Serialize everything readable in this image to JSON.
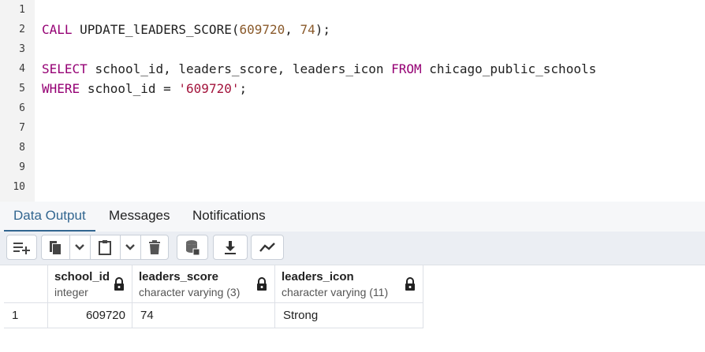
{
  "editor": {
    "line_numbers": [
      "1",
      "2",
      "3",
      "4",
      "5",
      "6",
      "7",
      "8",
      "9",
      "10"
    ],
    "line2": {
      "kw": "CALL",
      "fn": "UPDATE_lEADERS_SCORE",
      "open": "(",
      "arg1": "609720",
      "comma": ", ",
      "arg2": "74",
      "close": ");"
    },
    "line4": {
      "kw1": "SELECT",
      "cols": "school_id, leaders_score, leaders_icon",
      "kw2": "FROM",
      "table": "chicago_public_schools"
    },
    "line5": {
      "kw": "WHERE",
      "cond": "school_id = ",
      "val": "'609720'",
      "end": ";"
    }
  },
  "tabs": [
    {
      "label": "Data Output",
      "active": true
    },
    {
      "label": "Messages",
      "active": false
    },
    {
      "label": "Notifications",
      "active": false
    }
  ],
  "toolbar": {
    "icons": [
      "add-row-icon",
      "copy-icon",
      "chevron-down-icon",
      "paste-icon",
      "chevron-down-icon",
      "delete-icon",
      "save-data-icon",
      "download-icon",
      "graph-icon"
    ]
  },
  "grid": {
    "columns": [
      {
        "name": "school_id",
        "type": "integer"
      },
      {
        "name": "leaders_score",
        "type": "character varying (3)"
      },
      {
        "name": "leaders_icon",
        "type": "character varying (11)"
      }
    ],
    "rows": [
      {
        "num": "1",
        "cells": [
          "609720",
          "74",
          "Strong"
        ]
      }
    ]
  },
  "colors": {
    "keyword": "#950074",
    "number": "#8a5a2b",
    "string": "#a3143c",
    "tab_active": "#326690"
  }
}
